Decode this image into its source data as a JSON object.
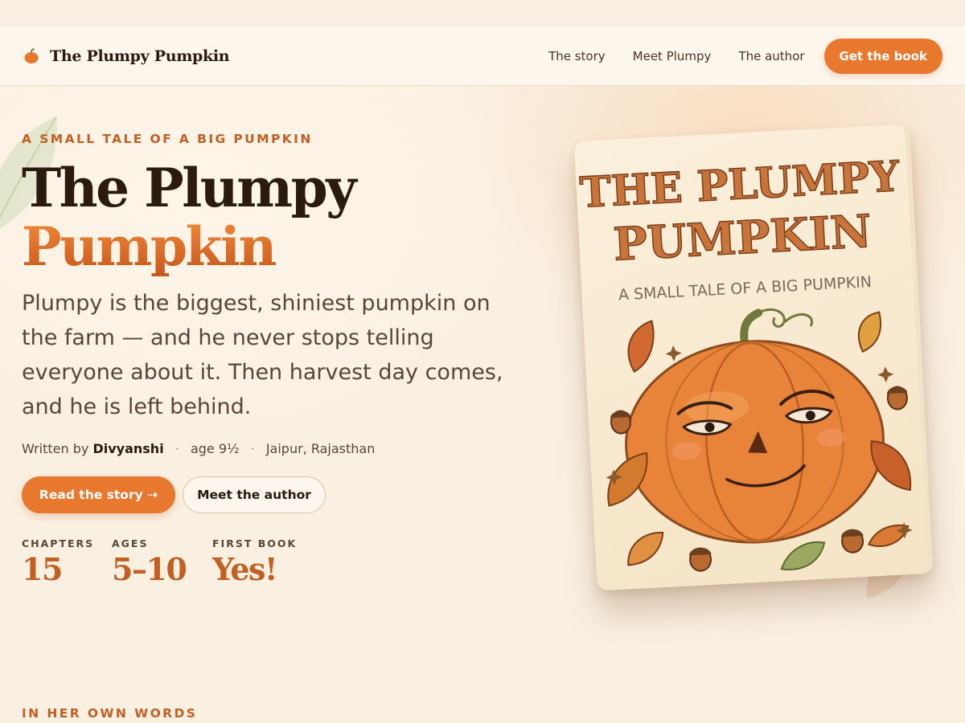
{
  "nav": {
    "brand": "The Plumpy Pumpkin",
    "links": [
      "The story",
      "Meet Plumpy",
      "The author"
    ],
    "cta": "Get the book"
  },
  "hero": {
    "eyebrow": "A SMALL TALE OF A BIG PUMPKIN",
    "title_line1": "The Plumpy",
    "title_line2": "Pumpkin",
    "lead": "Plumpy is the biggest, shiniest pumpkin on the farm — and he never stops telling everyone about it. Then harvest day comes, and he is left behind.",
    "byline": {
      "prefix": "Written by",
      "author": "Divyanshi",
      "sep": "·",
      "age": "age 9½",
      "location": "Jaipur, Rajasthan"
    },
    "primary_button": "Read the story ⇢",
    "secondary_button": "Meet the author",
    "stats": [
      {
        "label": "CHAPTERS",
        "value": "15"
      },
      {
        "label": "AGES",
        "value": "5–10"
      },
      {
        "label": "FIRST BOOK",
        "value": "Yes!"
      }
    ]
  },
  "book_cover": {
    "title_line1": "THE PLUMPY",
    "title_line2": "PUMPKIN",
    "subtitle": "A SMALL TALE OF A BIG PUMPKIN"
  },
  "next_section": {
    "eyebrow": "IN HER OWN WORDS"
  },
  "colors": {
    "accent": "#e8782e",
    "accent_dark": "#c25f22",
    "ink": "#2a1a10",
    "background": "#faf0e2"
  },
  "icons": {
    "brand": "pumpkin-icon"
  }
}
